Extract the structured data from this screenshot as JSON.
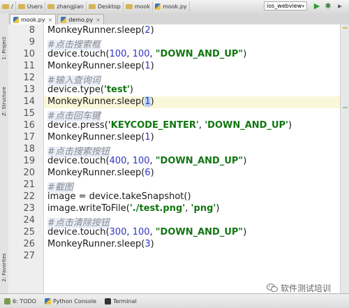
{
  "breadcrumb": [
    "/",
    "Users",
    "zhangjian",
    "Desktop",
    "mook",
    "mook.py"
  ],
  "run_config": "ios_webview",
  "tabs": [
    {
      "label": "mook.py",
      "active": true
    },
    {
      "label": "demo.py",
      "active": false
    }
  ],
  "sidebar_tabs": {
    "project": "1: Project",
    "structure": "Z: Structure",
    "favorites": "2: Favorites"
  },
  "code_lines": [
    {
      "n": "8",
      "text": "MonkeyRunner.sleep(2)"
    },
    {
      "n": "9",
      "text": "#点击搜索框"
    },
    {
      "n": "10",
      "text": "device.touch(100, 100, \"DOWN_AND_UP\")"
    },
    {
      "n": "11",
      "text": "MonkeyRunner.sleep(1)"
    },
    {
      "n": "12",
      "text": "#输入查询词"
    },
    {
      "n": "13",
      "text": "device.type('test')"
    },
    {
      "n": "14",
      "text": "MonkeyRunner.sleep(1)"
    },
    {
      "n": "15",
      "text": "#点击回车键"
    },
    {
      "n": "16",
      "text": "device.press('KEYCODE_ENTER', 'DOWN_AND_UP')"
    },
    {
      "n": "17",
      "text": "MonkeyRunner.sleep(1)"
    },
    {
      "n": "18",
      "text": "#点击搜索按钮"
    },
    {
      "n": "19",
      "text": "device.touch(400, 100, \"DOWN_AND_UP\")"
    },
    {
      "n": "20",
      "text": "MonkeyRunner.sleep(6)"
    },
    {
      "n": "21",
      "text": "#截图"
    },
    {
      "n": "22",
      "text": "image = device.takeSnapshot()"
    },
    {
      "n": "23",
      "text": "image.writeToFile('./test.png', 'png')"
    },
    {
      "n": "24",
      "text": "#点击清除按钮"
    },
    {
      "n": "25",
      "text": "device.touch(300, 100, \"DOWN_AND_UP\")"
    },
    {
      "n": "26",
      "text": "MonkeyRunner.sleep(3)"
    },
    {
      "n": "27",
      "text": ""
    }
  ],
  "current_line": "14",
  "status_tabs": {
    "todo": "6: TODO",
    "console": "Python Console",
    "terminal": "Terminal"
  },
  "watermark": "软件测试培训",
  "colors": {
    "string": "#117611",
    "number": "#2f33c7",
    "comment": "#8c8c8c",
    "current_line_bg": "#fbf7d9"
  }
}
